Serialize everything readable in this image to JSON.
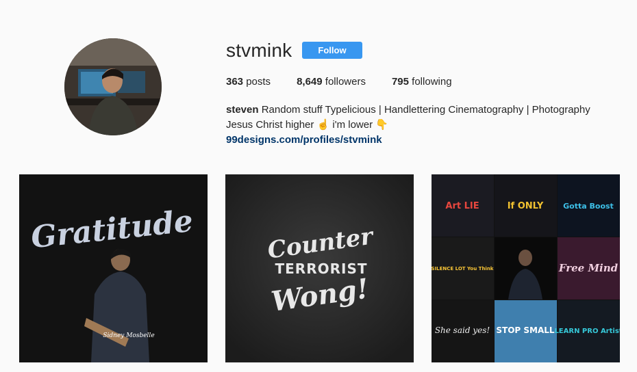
{
  "profile": {
    "username": "stvmink",
    "follow_label": "Follow",
    "stats": {
      "posts_count": "363",
      "posts_label": "posts",
      "followers_count": "8,649",
      "followers_label": "followers",
      "following_count": "795",
      "following_label": "following"
    },
    "bio": {
      "name": "steven",
      "line1": "Random stuff Typelicious | Handlettering Cinematography | Photography",
      "line2": "Jesus Christ higher ☝ i'm lower 👇",
      "link": "99designs.com/profiles/stvmink"
    }
  },
  "posts": [
    {
      "art_text": "Gratitude",
      "signature": "Sidney Mosbelle"
    },
    {
      "art_line1": "Counter",
      "art_line2": "TERRORIST",
      "art_line3": "Wong!"
    },
    {
      "tiles": [
        "Art LIE",
        "If ONLY",
        "Gotta Boost",
        "SILENCE LOT You Think",
        "",
        "Free Mind",
        "She said yes!",
        "STOP SMALL",
        "LEARN PRO Artist"
      ]
    }
  ],
  "colors": {
    "follow_button": "#3897f0",
    "link": "#003569",
    "background": "#fafafa"
  }
}
